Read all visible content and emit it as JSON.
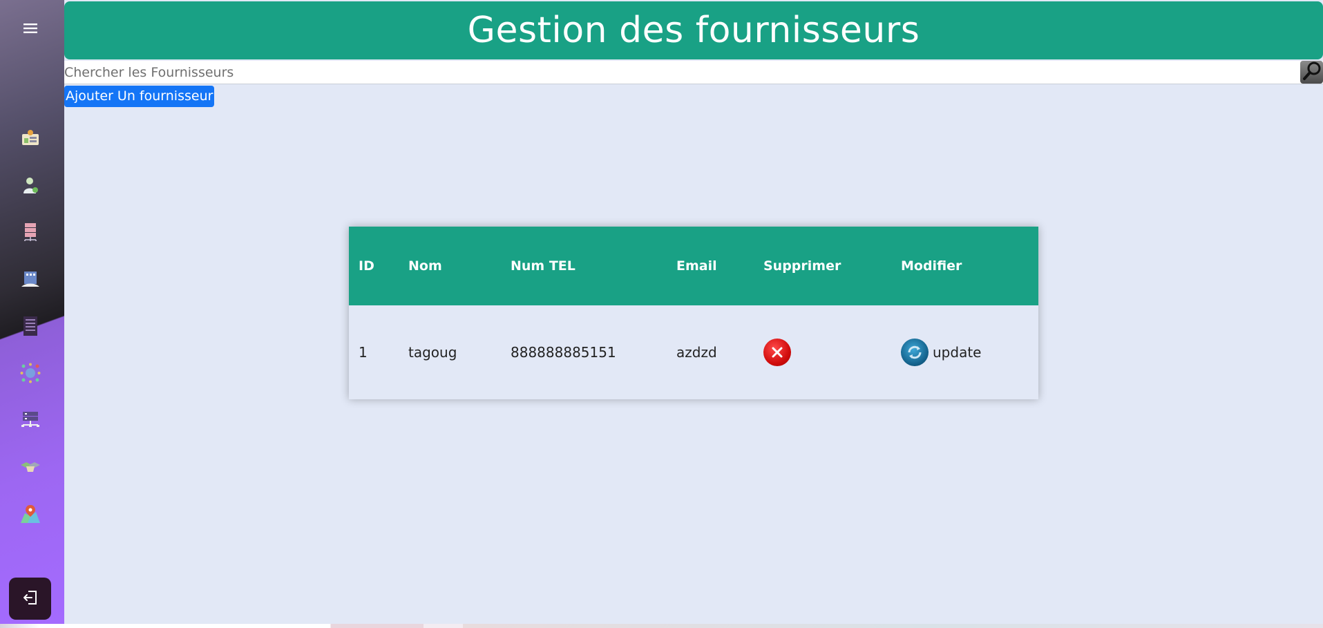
{
  "header": {
    "title": "Gestion des fournisseurs"
  },
  "search": {
    "placeholder": "Chercher les Fournisseurs",
    "value": ""
  },
  "actions": {
    "add_label": "Ajouter Un fournisseur"
  },
  "sidebar": {
    "items": [
      {
        "icon": "dashboard-icon"
      },
      {
        "icon": "user-add-icon"
      },
      {
        "icon": "server-rack-icon"
      },
      {
        "icon": "hospital-icon"
      },
      {
        "icon": "cabinet-icon"
      },
      {
        "icon": "network-icon"
      },
      {
        "icon": "database-icon"
      },
      {
        "icon": "handshake-icon"
      },
      {
        "icon": "map-pin-icon"
      }
    ],
    "logout_icon": "logout-icon"
  },
  "table": {
    "columns": [
      "ID",
      "Nom",
      "Num TEL",
      "Email",
      "Supprimer",
      "Modifier"
    ],
    "rows": [
      {
        "id": "1",
        "nom": "tagoug",
        "tel": "888888885151",
        "email": "azdzd",
        "update_label": "update"
      }
    ]
  },
  "colors": {
    "primary": "#19a185",
    "button_blue": "#1475f6",
    "background": "#e2e8f6",
    "sidebar_purple": "#a46bff"
  }
}
